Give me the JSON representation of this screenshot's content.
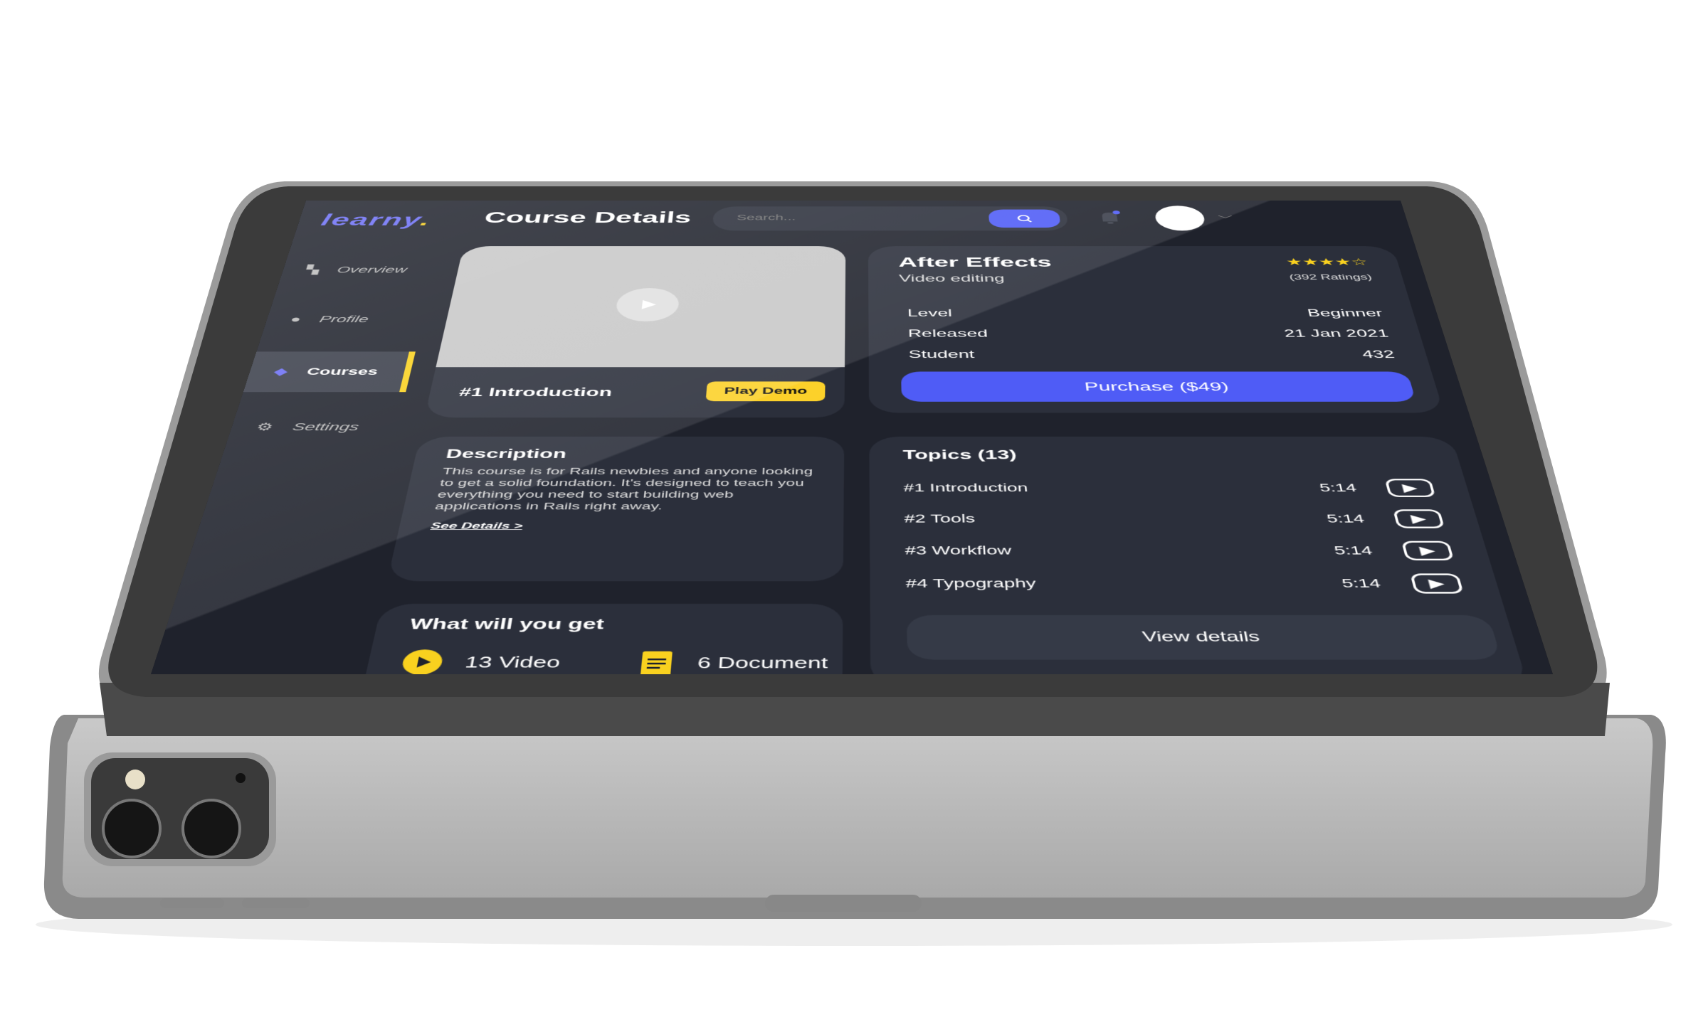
{
  "app": {
    "logo": "learny",
    "logo_dot": ".",
    "page_title": "Course Details"
  },
  "search": {
    "placeholder": "Search...",
    "icon": "search-icon"
  },
  "sidebar": {
    "items": [
      {
        "label": "Overview",
        "icon": "grid-icon"
      },
      {
        "label": "Profile",
        "icon": "user-icon"
      },
      {
        "label": "Courses",
        "icon": "layers-icon",
        "active": true
      },
      {
        "label": "Settings",
        "icon": "gear-icon"
      }
    ]
  },
  "video": {
    "title": "#1  Introduction",
    "play_demo": "Play Demo"
  },
  "course": {
    "name": "After Effects",
    "category": "Video editing",
    "rating": 4,
    "rating_max": 5,
    "ratings_count": "(392 Ratings)",
    "details": [
      {
        "label": "Level",
        "value": "Beginner"
      },
      {
        "label": "Released",
        "value": "21 Jan 2021"
      },
      {
        "label": "Student",
        "value": "432"
      }
    ],
    "purchase": "Purchase ($49)"
  },
  "description": {
    "heading": "Description",
    "text": "This course is for Rails newbies and anyone looking to get a solid foundation. It's designed to teach you everything you need to start building web applications in Rails right away.",
    "link": "See Details >"
  },
  "topics": {
    "heading": "Topics (13)",
    "items": [
      {
        "name": "#1 Introduction",
        "duration": "5:14"
      },
      {
        "name": "#2 Tools",
        "duration": "5:14"
      },
      {
        "name": "#3 Workflow",
        "duration": "5:14"
      },
      {
        "name": "#4 Typography",
        "duration": "5:14"
      }
    ],
    "view_details": "View details"
  },
  "get": {
    "heading": "What will you get",
    "items": [
      {
        "label": "13 Video",
        "icon": "play-circle-icon"
      },
      {
        "label": "6 Document",
        "icon": "document-icon"
      }
    ]
  },
  "colors": {
    "accent": "#4f5cf6",
    "highlight": "#f9d11f",
    "background": "#1f222c",
    "card": "#2b2f3b"
  }
}
